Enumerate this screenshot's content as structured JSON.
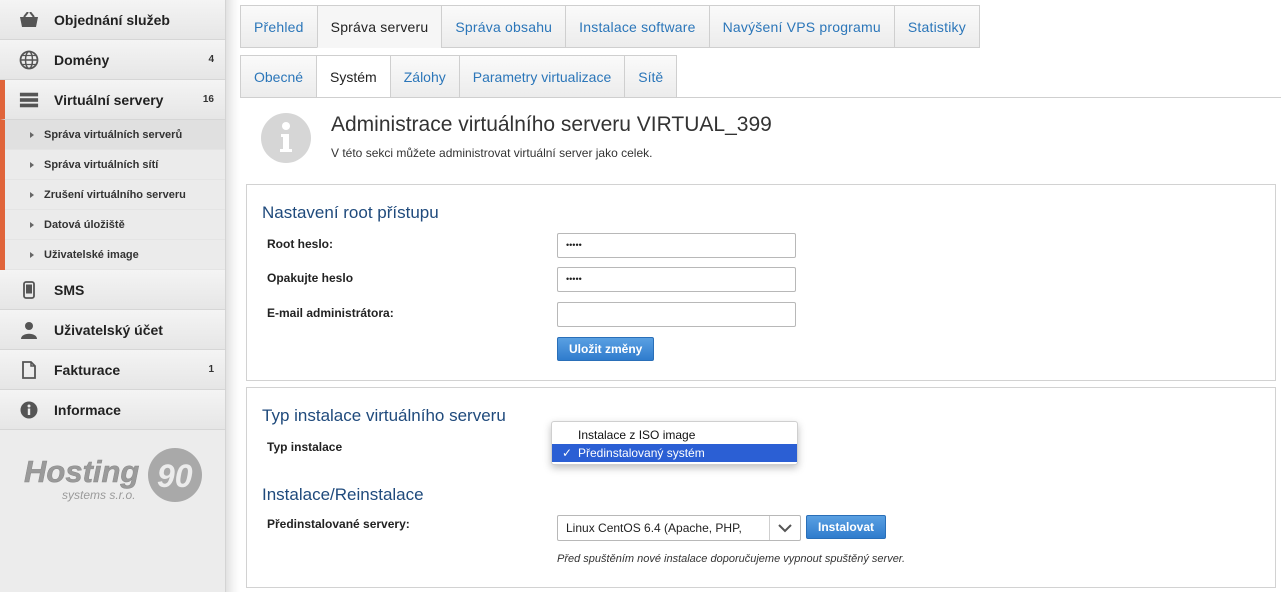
{
  "sidebar": {
    "items": [
      {
        "label": "Objednání služeb",
        "count": ""
      },
      {
        "label": "Domény",
        "count": "4"
      },
      {
        "label": "Virtuální servery",
        "count": "16"
      },
      {
        "label": "SMS",
        "count": ""
      },
      {
        "label": "Uživatelský účet",
        "count": ""
      },
      {
        "label": "Fakturace",
        "count": "1"
      },
      {
        "label": "Informace",
        "count": ""
      }
    ],
    "subitems": [
      "Správa virtuálních serverů",
      "Správa virtuálních sítí",
      "Zrušení virtuálního serveru",
      "Datová úložiště",
      "Uživatelské image"
    ],
    "logo_text": "Hosting",
    "logo_number": "90",
    "logo_sub": "systems s.r.o."
  },
  "tabs": [
    "Přehled",
    "Správa serveru",
    "Správa obsahu",
    "Instalace software",
    "Navýšení VPS programu",
    "Statistiky"
  ],
  "subtabs": [
    "Obecné",
    "Systém",
    "Zálohy",
    "Parametry virtualizace",
    "Sítě"
  ],
  "header": {
    "title": "Administrace virtuálního serveru VIRTUAL_399",
    "description": "V této sekci můžete administrovat virtuální server jako celek."
  },
  "root_section": {
    "title": "Nastavení root přístupu",
    "root_password_label": "Root heslo:",
    "root_password_value": "•••••",
    "repeat_password_label": "Opakujte heslo",
    "repeat_password_value": "•••••",
    "email_label": "E-mail administrátora:",
    "email_value": "",
    "save_button": "Uložit změny"
  },
  "install_type_section": {
    "title": "Typ instalace virtuálního serveru",
    "label": "Typ instalace",
    "options": [
      "Instalace z ISO image",
      "Předinstalovaný systém"
    ],
    "selected": "Předinstalovaný systém",
    "check_mark": "✓"
  },
  "reinstall_section": {
    "title": "Instalace/Reinstalace",
    "label": "Předinstalované servery:",
    "selected_server": "Linux CentOS 6.4 (Apache, PHP,",
    "install_button": "Instalovat",
    "hint": "Před spuštěním nové instalace doporučujeme vypnout spuštěný server."
  },
  "colors": {
    "accent": "#e0643a",
    "link": "#2b76b9",
    "section_title": "#1f4a7c",
    "button": "#3a87d6",
    "dropdown_selected": "#2b5fd4"
  }
}
